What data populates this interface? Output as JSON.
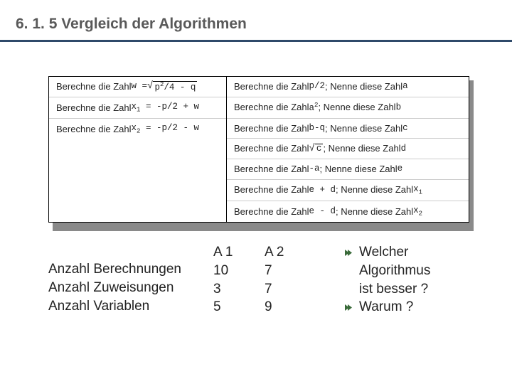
{
  "title": "6. 1. 5  Vergleich der Algorithmen",
  "left": {
    "r1_pre": "Berechne die Zahl ",
    "r1_w": "w = ",
    "r1_rad": "p²/4 - q",
    "r2_pre": "Berechne die Zahl ",
    "r2_expr": "x₁ = -p/2 + w",
    "r3_pre": "Berechne die Zahl ",
    "r3_expr": "x₂ = -p/2 - w"
  },
  "right": {
    "r1_a": "Berechne die Zahl ",
    "r1_v": "p/2",
    "r1_b": "; Nenne diese Zahl ",
    "r1_n": "a",
    "r2_a": "Berechne die Zahl ",
    "r2_v": "a²",
    "r2_b": "; Nenne diese Zahl ",
    "r2_n": "b",
    "r3_a": "Berechne die Zahl ",
    "r3_v": "b-q",
    "r3_b": "; Nenne diese Zahl ",
    "r3_n": "c",
    "r4_a": "Berechne die Zahl ",
    "r4_v": "c",
    "r4_b": " ; Nenne diese Zahl ",
    "r4_n": "d",
    "r5_a": "Berechne die Zahl ",
    "r5_v": "-a",
    "r5_b": "; Nenne diese Zahl ",
    "r5_n": "e",
    "r6_a": "Berechne die Zahl ",
    "r6_v": "e + d",
    "r6_b": "; Nenne diese Zahl ",
    "r6_n": "x₁",
    "r7_a": "Berechne die Zahl ",
    "r7_v": "e - d",
    "r7_b": "; Nenne diese Zahl ",
    "r7_n": "x₂"
  },
  "metrics": {
    "m1": "Anzahl Berechnungen",
    "m2": "Anzahl Zuweisungen",
    "m3": "Anzahl Variablen"
  },
  "a1": {
    "hd": "A 1",
    "v1": "10",
    "v2": "3",
    "v3": "5"
  },
  "a2": {
    "hd": "A 2",
    "v1": "7",
    "v2": "7",
    "v3": "9"
  },
  "question": {
    "l1": "Welcher",
    "l2": "Algorithmus",
    "l3": "ist besser ?",
    "l4": "Warum ?"
  }
}
